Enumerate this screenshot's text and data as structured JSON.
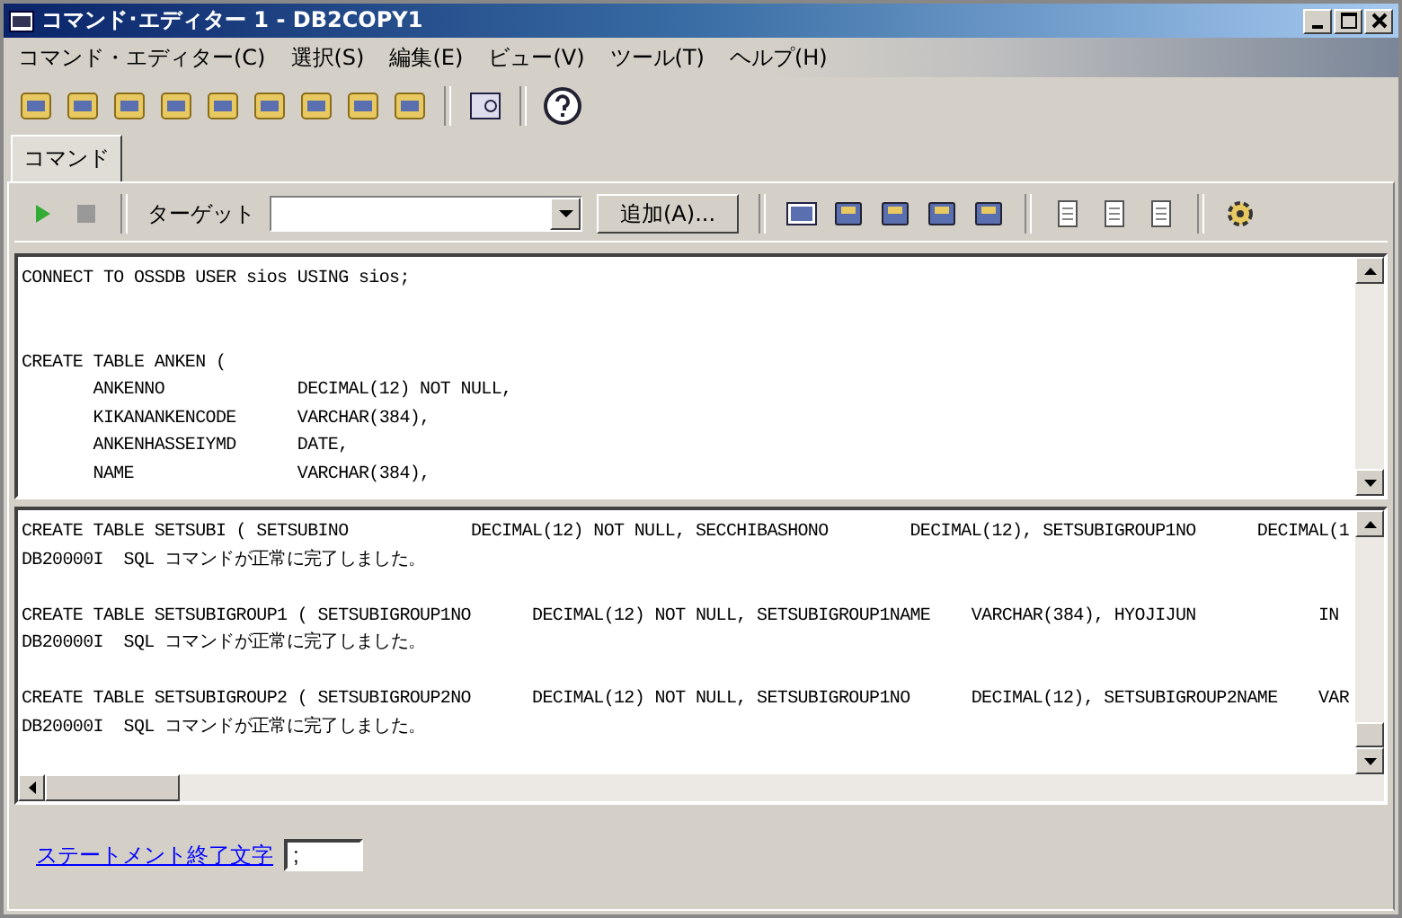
{
  "window": {
    "title": "コマンド･エディター 1 - DB2COPY1"
  },
  "menu": [
    "コマンド・エディター(C)",
    "選択(S)",
    "編集(E)",
    "ビュー(V)",
    "ツール(T)",
    "ヘルプ(H)"
  ],
  "tabs": [
    {
      "label": "コマンド",
      "selected": true
    }
  ],
  "editor_toolbar": {
    "target_label": "ターゲット",
    "add_button": "追加(A)..."
  },
  "editor": {
    "blocks": [
      [
        "CONNECT TO OSSDB USER sios USING sios;"
      ],
      [
        "CREATE TABLE ANKEN (",
        "       ANKENNO             DECIMAL(12) NOT NULL,",
        "       KIKANANKENCODE      VARCHAR(384),",
        "       ANKENHASSEIYMD      DATE,",
        "       NAME                VARCHAR(384),"
      ]
    ]
  },
  "output": {
    "blocks": [
      [
        "CREATE TABLE SETSUBI ( SETSUBINO            DECIMAL(12) NOT NULL, SECCHIBASHONO        DECIMAL(12), SETSUBIGROUP1NO      DECIMAL(1",
        "DB20000I  SQL コマンドが正常に完了しました。"
      ],
      [
        "CREATE TABLE SETSUBIGROUP1 ( SETSUBIGROUP1NO      DECIMAL(12) NOT NULL, SETSUBIGROUP1NAME    VARCHAR(384), HYOJIJUN            IN",
        "DB20000I  SQL コマンドが正常に完了しました。"
      ],
      [
        "CREATE TABLE SETSUBIGROUP2 ( SETSUBIGROUP2NO      DECIMAL(12) NOT NULL, SETSUBIGROUP1NO      DECIMAL(12), SETSUBIGROUP2NAME    VAR",
        "DB20000I  SQL コマンドが正常に完了しました。"
      ]
    ]
  },
  "footer": {
    "link": "ステートメント終了文字",
    "terminator_value": ";"
  }
}
